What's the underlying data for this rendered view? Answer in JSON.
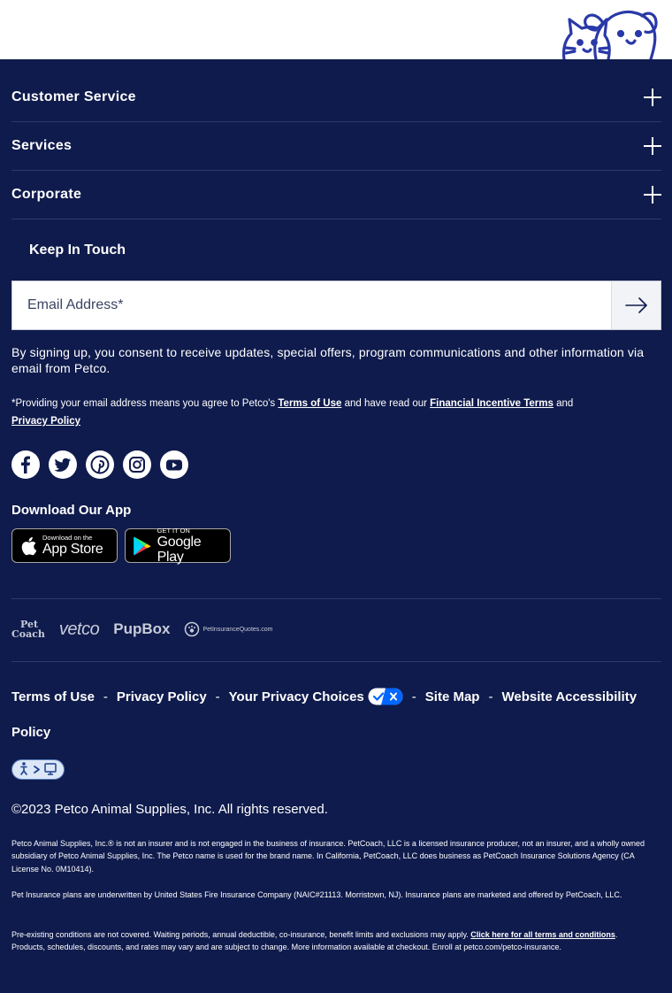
{
  "header": {
    "mascot": "cat-and-dog-logo"
  },
  "accordions": [
    {
      "label": "Customer Service"
    },
    {
      "label": "Services"
    },
    {
      "label": "Corporate"
    }
  ],
  "newsletter": {
    "title": "Keep In Touch",
    "email_placeholder": "Email Address*",
    "consent": "By signing up, you consent to receive updates, special offers, program communications and other information via email from Petco.",
    "agree_prefix": "*Providing your email address means you agree to Petco's",
    "terms_link": "Terms of Use",
    "agree_middle": "and have read our",
    "incentive_link": "Financial Incentive Terms",
    "agree_and": "and",
    "privacy_link": "Privacy Policy"
  },
  "social": [
    "facebook-icon",
    "twitter-icon",
    "pinterest-icon",
    "instagram-icon",
    "youtube-icon"
  ],
  "app": {
    "title": "Download Our App",
    "apple_small": "Download on the",
    "apple_big": "App Store",
    "google_small": "GET IT ON",
    "google_big": "Google Play"
  },
  "brands": {
    "petcoach_1": "Pet",
    "petcoach_2": "Coach",
    "vetco": "vetco",
    "pupbox": "PupBox",
    "quotes": "PetInsuranceQuotes.com"
  },
  "footer_links": {
    "terms": "Terms of Use",
    "privacy": "Privacy Policy",
    "choices": "Your Privacy Choices",
    "sitemap": "Site Map",
    "accessibility": "Website Accessibility Policy",
    "separator": "-"
  },
  "copyright": "©2023 Petco Animal Supplies, Inc. All rights reserved.",
  "legal": {
    "p1": "Petco Animal Supplies, Inc.® is not an insurer and is not engaged in the business of insurance. PetCoach, LLC is a licensed insurance producer, not an insurer, and a wholly owned subsidiary of Petco Animal Supplies, Inc. The Petco name is used for the brand name. In California, PetCoach, LLC does business as PetCoach Insurance Solutions Agency (CA License No. 0M10414).",
    "p2": "Pet Insurance plans are underwritten by United States Fire Insurance Company (NAIC#21113. Morristown, NJ). Insurance plans are marketed and offered by PetCoach, LLC.",
    "p3_prefix": "Pre-existing conditions are not covered. Waiting periods, annual deductible, co-insurance, benefit limits and exclusions may apply.",
    "p3_link": "Click here for all terms and conditions",
    "p3_suffix": ". Products, schedules, discounts, and rates may vary and are subject to change. More information available at checkout. Enroll at petco.com/petco-insurance."
  }
}
